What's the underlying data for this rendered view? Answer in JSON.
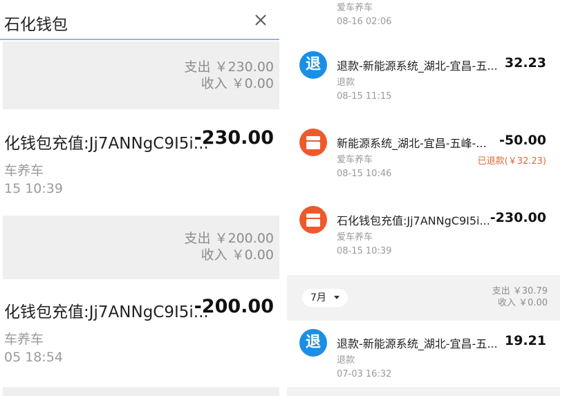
{
  "left": {
    "search": {
      "query": "石化钱包"
    },
    "groups": [
      {
        "summary": {
          "expense": "支出 ￥230.00",
          "income": "收入 ￥0.00"
        },
        "transaction": {
          "title": "化钱包充值:Jj7ANNgC9I5i...",
          "amount": "-230.00",
          "sub": "车养车",
          "time": "15 10:39"
        }
      },
      {
        "summary": {
          "expense": "支出 ￥200.00",
          "income": "收入 ￥0.00"
        },
        "transaction": {
          "title": "化钱包充值:Jj7ANNgC9I5i...",
          "amount": "-200.00",
          "sub": "车养车",
          "time": "05 18:54"
        }
      }
    ]
  },
  "right": {
    "top_partial": {
      "sub": "爱车养车",
      "time": "08-16 02:06"
    },
    "transactions": [
      {
        "icon": "退",
        "title": "退款-新能源系统_湖北-宜昌-五...",
        "amount": "32.23",
        "sub": "退款",
        "time": "08-15 11:15"
      },
      {
        "title": "新能源系统_湖北-宜昌-五峰-...",
        "amount": "-50.00",
        "sub": "爱车养车",
        "time": "08-15 10:46",
        "refunded": "已退款(￥32.23)"
      },
      {
        "title": "石化钱包充值:Jj7ANNgC9I5i...",
        "amount": "-230.00",
        "sub": "爱车养车",
        "time": "08-15 10:39"
      }
    ],
    "month_summary": {
      "month": "7月",
      "expense": "支出 ￥30.79",
      "income": "收入 ￥0.00"
    },
    "july_transactions": [
      {
        "icon": "退",
        "title": "退款-新能源系统_湖北-宜昌-五...",
        "amount": "19.21",
        "sub": "退款",
        "time": "07-03 16:32"
      }
    ]
  },
  "colors": {
    "refund_icon": "#1a8fe3",
    "shop_icon": "#ee5a2b",
    "refunded_text": "#d96b3a",
    "search_underline": "#8fb4e6"
  },
  "icons": {
    "search_clear": "close-icon",
    "month_dropdown": "caret-down-icon",
    "refund": "refund-icon",
    "shop": "shop-icon"
  }
}
